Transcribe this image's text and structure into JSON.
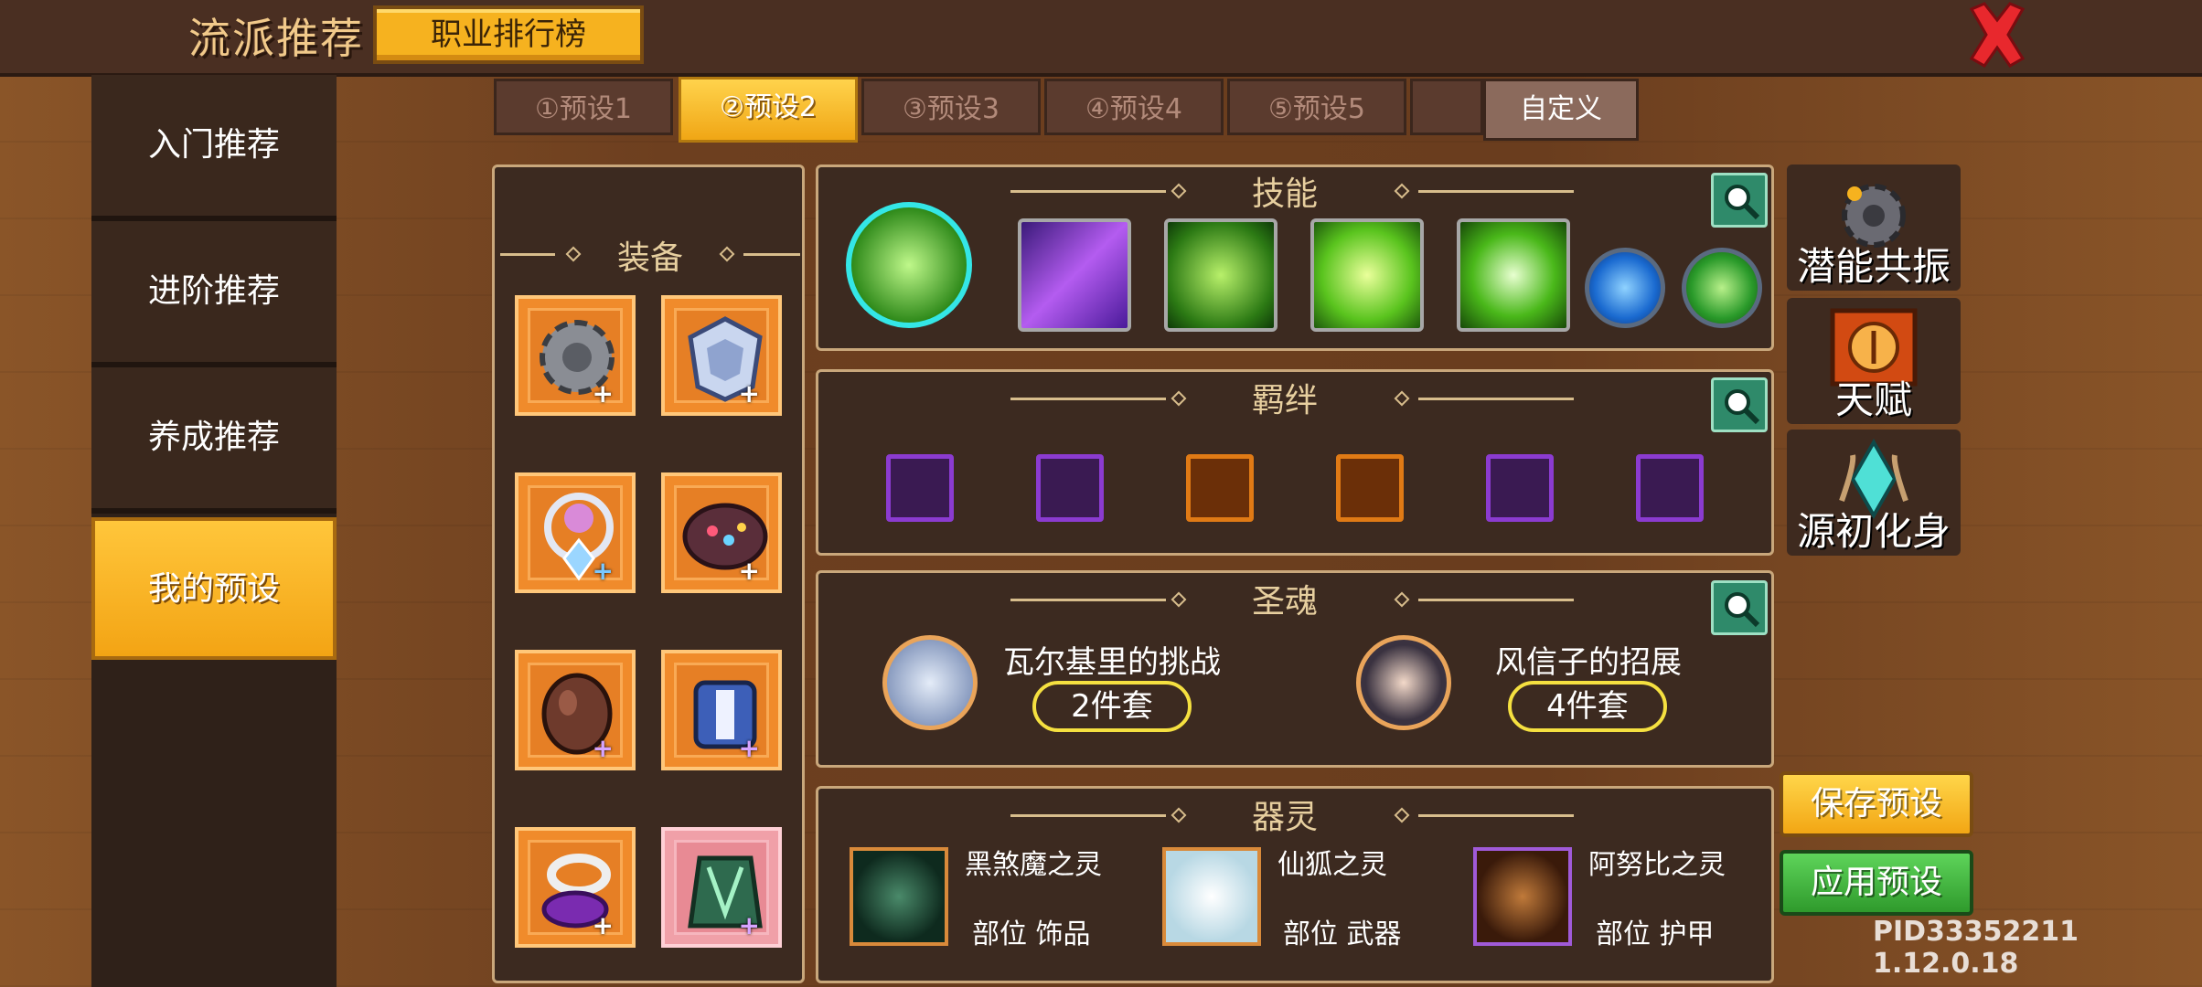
{
  "header": {
    "title": "流派推荐",
    "rank_button": "职业排行榜"
  },
  "nav": {
    "items": [
      {
        "label": "入门推荐"
      },
      {
        "label": "进阶推荐"
      },
      {
        "label": "养成推荐"
      },
      {
        "label": "我的预设"
      }
    ],
    "active_index": 3
  },
  "tabs": [
    {
      "label": "①预设1"
    },
    {
      "label": "②预设2"
    },
    {
      "label": "③预设3"
    },
    {
      "label": "④预设4"
    },
    {
      "label": "⑤预设5"
    },
    {
      "label": "自定义"
    }
  ],
  "active_tab": 1,
  "equipment": {
    "title": "装备"
  },
  "skills": {
    "title": "技能"
  },
  "bonds": {
    "title": "羁绊"
  },
  "souls": {
    "title": "圣魂",
    "items": [
      {
        "name": "瓦尔基里的挑战",
        "set": "2件套"
      },
      {
        "name": "风信子的招展",
        "set": "4件套"
      }
    ]
  },
  "spirits": {
    "title": "器灵",
    "items": [
      {
        "name": "黑煞魔之灵",
        "slot": "部位 饰品"
      },
      {
        "name": "仙狐之灵",
        "slot": "部位 武器"
      },
      {
        "name": "阿努比之灵",
        "slot": "部位 护甲"
      }
    ]
  },
  "side": {
    "potential": "潜能共振",
    "talent": "天赋",
    "origin": "源初化身"
  },
  "actions": {
    "save": "保存预设",
    "apply": "应用预设"
  },
  "version": "PID33352211 1.12.0.18",
  "colors": {
    "accent": "#f6b21f",
    "panel": "#3c2a20",
    "border": "#c9a77b",
    "green": "#3fb54c"
  }
}
